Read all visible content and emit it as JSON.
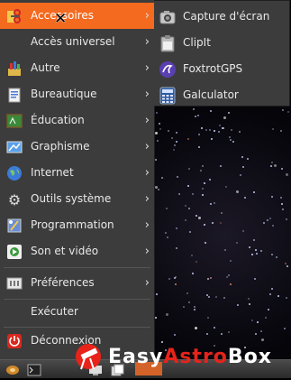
{
  "menu": {
    "items": [
      {
        "label": "Accessoires",
        "icon": "scissors-icon"
      },
      {
        "label": "Accès universel",
        "icon": "accessibility-icon"
      },
      {
        "label": "Autre",
        "icon": "other-icon"
      },
      {
        "label": "Bureautique",
        "icon": "office-icon"
      },
      {
        "label": "Éducation",
        "icon": "education-icon"
      },
      {
        "label": "Graphisme",
        "icon": "graphics-icon"
      },
      {
        "label": "Internet",
        "icon": "globe-icon"
      },
      {
        "label": "Outils système",
        "icon": "gear-icon"
      },
      {
        "label": "Programmation",
        "icon": "programming-icon"
      },
      {
        "label": "Son et vidéo",
        "icon": "multimedia-icon"
      }
    ],
    "preferences": "Préférences",
    "run": "Exécuter",
    "logout": "Déconnexion"
  },
  "submenu": {
    "items": [
      {
        "label": "Capture d'écran",
        "icon": "screenshot-icon"
      },
      {
        "label": "ClipIt",
        "icon": "clipboard-icon"
      },
      {
        "label": "FoxtrotGPS",
        "icon": "gps-icon"
      },
      {
        "label": "Galculator",
        "icon": "calculator-icon"
      }
    ]
  },
  "brand": {
    "part1": "Easy",
    "part2": "Astro",
    "part3": "Box"
  },
  "colors": {
    "highlight": "#f46a1f",
    "menu_bg": "#3c3c3c",
    "brand_red": "#e8231a"
  }
}
